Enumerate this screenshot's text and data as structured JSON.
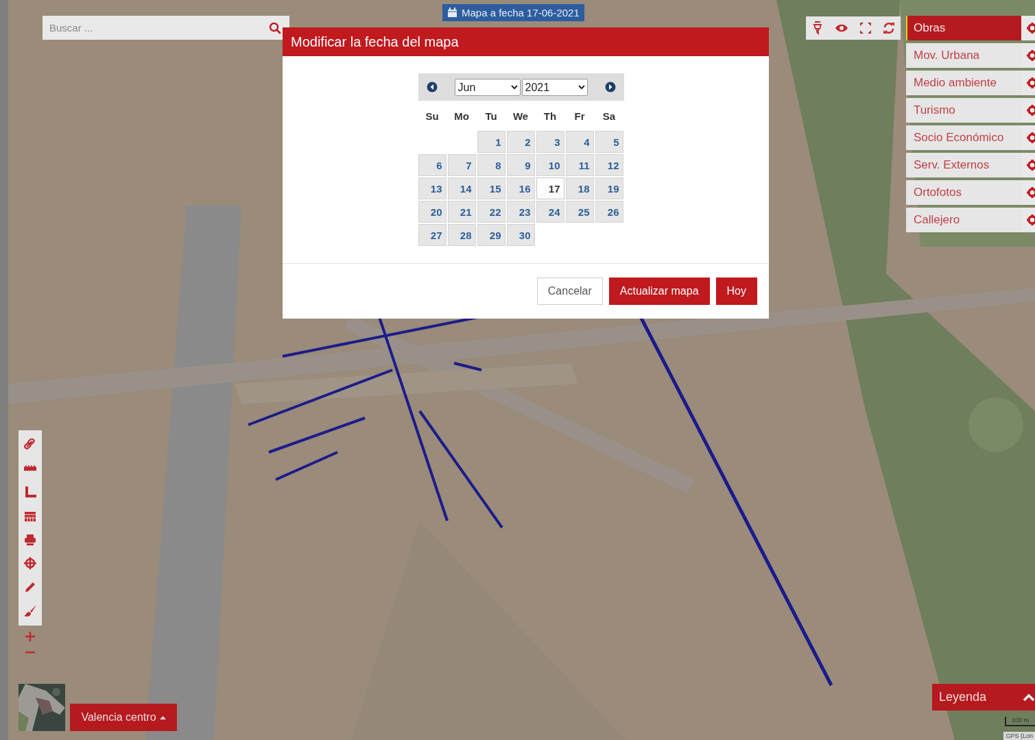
{
  "search": {
    "placeholder": "Buscar ..."
  },
  "date_badge": {
    "text": "Mapa a fecha 17-06-2021"
  },
  "layers": [
    {
      "label": "Obras",
      "selected": true
    },
    {
      "label": "Mov. Urbana",
      "selected": false
    },
    {
      "label": "Medio ambiente",
      "selected": false
    },
    {
      "label": "Turismo",
      "selected": false
    },
    {
      "label": "Socio Económico",
      "selected": false
    },
    {
      "label": "Serv. Externos",
      "selected": false
    },
    {
      "label": "Ortofotos",
      "selected": false
    },
    {
      "label": "Callejero",
      "selected": false
    }
  ],
  "dialog": {
    "title": "Modificar la fecha del mapa",
    "calendar": {
      "month": "Jun",
      "year": "2021",
      "weekdays": [
        "Su",
        "Mo",
        "Tu",
        "We",
        "Th",
        "Fr",
        "Sa"
      ],
      "weeks": [
        [
          {
            "kind": "blank"
          },
          {
            "kind": "blank"
          },
          {
            "kind": "day",
            "label": "1",
            "selected": false
          },
          {
            "kind": "day",
            "label": "2",
            "selected": false
          },
          {
            "kind": "day",
            "label": "3",
            "selected": false
          },
          {
            "kind": "day",
            "label": "4",
            "selected": false
          },
          {
            "kind": "day",
            "label": "5",
            "selected": false
          }
        ],
        [
          {
            "kind": "day",
            "label": "6",
            "selected": false
          },
          {
            "kind": "day",
            "label": "7",
            "selected": false
          },
          {
            "kind": "day",
            "label": "8",
            "selected": false
          },
          {
            "kind": "day",
            "label": "9",
            "selected": false
          },
          {
            "kind": "day",
            "label": "10",
            "selected": false
          },
          {
            "kind": "day",
            "label": "11",
            "selected": false
          },
          {
            "kind": "day",
            "label": "12",
            "selected": false
          }
        ],
        [
          {
            "kind": "day",
            "label": "13",
            "selected": false
          },
          {
            "kind": "day",
            "label": "14",
            "selected": false
          },
          {
            "kind": "day",
            "label": "15",
            "selected": false
          },
          {
            "kind": "day",
            "label": "16",
            "selected": false
          },
          {
            "kind": "day",
            "label": "17",
            "selected": true
          },
          {
            "kind": "day",
            "label": "18",
            "selected": false
          },
          {
            "kind": "day",
            "label": "19",
            "selected": false
          }
        ],
        [
          {
            "kind": "day",
            "label": "20",
            "selected": false
          },
          {
            "kind": "day",
            "label": "21",
            "selected": false
          },
          {
            "kind": "day",
            "label": "22",
            "selected": false
          },
          {
            "kind": "day",
            "label": "23",
            "selected": false
          },
          {
            "kind": "day",
            "label": "24",
            "selected": false
          },
          {
            "kind": "day",
            "label": "25",
            "selected": false
          },
          {
            "kind": "day",
            "label": "26",
            "selected": false
          }
        ],
        [
          {
            "kind": "day",
            "label": "27",
            "selected": false
          },
          {
            "kind": "day",
            "label": "28",
            "selected": false
          },
          {
            "kind": "day",
            "label": "29",
            "selected": false
          },
          {
            "kind": "day",
            "label": "30",
            "selected": false
          }
        ]
      ]
    },
    "buttons": [
      {
        "label": "Cancelar",
        "kind": "secondary"
      },
      {
        "label": "Actualizar mapa",
        "kind": "primary"
      },
      {
        "label": "Hoy",
        "kind": "primary"
      }
    ]
  },
  "location_button": {
    "label": "Valencia centro"
  },
  "legend_button": {
    "label": "Leyenda"
  },
  "scale": {
    "label": "100 m"
  },
  "coordinates": {
    "label": "GPS (Lon"
  }
}
